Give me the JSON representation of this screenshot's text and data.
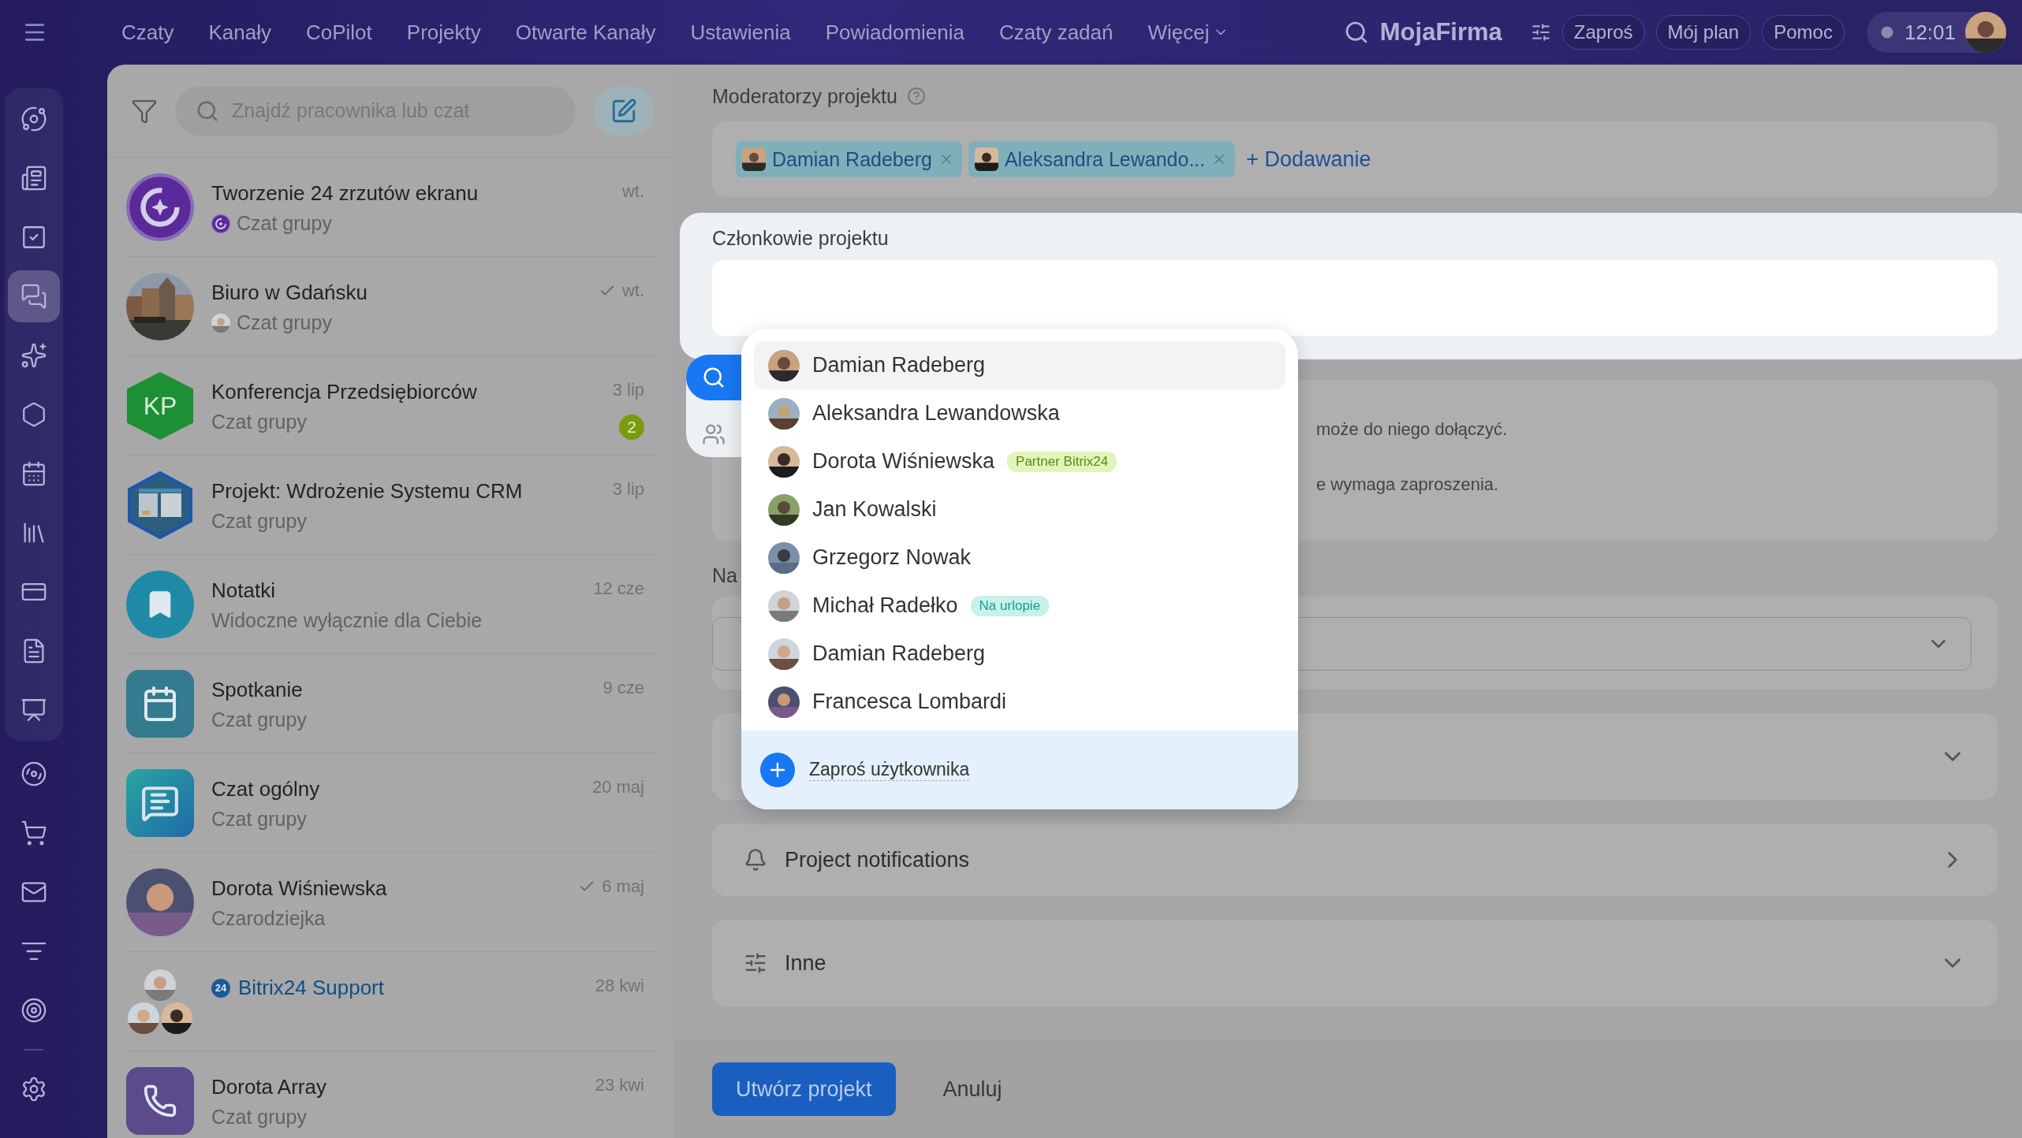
{
  "top_bar": {
    "nav": [
      "Czaty",
      "Kanały",
      "CoPilot",
      "Projekty",
      "Otwarte Kanały",
      "Ustawienia",
      "Powiadomienia",
      "Czaty zadań"
    ],
    "more": "Więcej",
    "brand": "MojaFirma",
    "buttons": [
      "Zaproś",
      "Mój plan",
      "Pomoc"
    ],
    "time": "12:01"
  },
  "rail": {
    "items": [
      {
        "selected": false
      },
      {
        "selected": false
      },
      {
        "selected": false
      },
      {
        "selected": true
      },
      {
        "selected": false
      },
      {
        "selected": false
      },
      {
        "selected": false
      },
      {
        "selected": false
      },
      {
        "selected": false
      },
      {
        "selected": false
      },
      {
        "selected": false
      },
      {
        "selected": false
      },
      {
        "selected": false
      },
      {
        "selected": false
      },
      {
        "selected": false
      },
      {
        "selected": false
      },
      {
        "selected": false
      }
    ]
  },
  "chat_list": {
    "search_placeholder": "Znajdź pracownika lub czat",
    "chats": [
      {
        "kind": "copilot",
        "title": "Tworzenie 24 zrzutów ekranu",
        "subtitle": "Czat grupy",
        "subtitle_icon": {
          "kind": "copilot"
        },
        "time": "wt.",
        "read": false
      },
      {
        "kind": "city",
        "title": "Biuro w Gdańsku",
        "subtitle": "Czat grupy",
        "subtitle_icon": {
          "kind": "person"
        },
        "time": "wt.",
        "read": true
      },
      {
        "kind": "initials",
        "title": "Konferencja Przedsiębiorców",
        "subtitle": "Czat grupy",
        "time": "3 lip",
        "read": false,
        "unread": "2",
        "initials": "KP"
      },
      {
        "kind": "hexphoto",
        "title": "Projekt: Wdrożenie Systemu CRM",
        "subtitle": "Czat grupy",
        "time": "3 lip",
        "read": false
      },
      {
        "kind": "notes",
        "title": "Notatki",
        "subtitle": "Widoczne wyłącznie dla Ciebie",
        "time": "12 cze",
        "read": false
      },
      {
        "kind": "calendar",
        "title": "Spotkanie",
        "subtitle": "Czat grupy",
        "time": "9 cze",
        "read": false
      },
      {
        "kind": "chat",
        "title": "Czat ogólny",
        "subtitle": "Czat grupy",
        "time": "20 maj",
        "read": false
      },
      {
        "title": "Dorota Wiśniewska",
        "subtitle": "Czarodziejka",
        "time": "6 maj",
        "read": true
      },
      {
        "kind": "group",
        "title": "Bitrix24 Support",
        "badge": "24",
        "time": "28 kwi",
        "read": false
      },
      {
        "kind": "phone",
        "title": "Dorota Array",
        "subtitle": "Czat grupy",
        "time": "23 kwi",
        "read": false
      }
    ]
  },
  "project_form": {
    "moderators": {
      "label": "Moderatorzy projektu",
      "chips": [
        "Damian Radeberg",
        "Aleksandra Lewando..."
      ],
      "add": "+ Dodawanie"
    },
    "members": {
      "label": "Członkowie projektu"
    },
    "info_lines": [
      "może do niego dołączyć.",
      "e wymaga zaproszenia."
    ],
    "cut_label": "Na",
    "notifications": "Project notifications",
    "other": "Inne",
    "create_button": "Utwórz projekt",
    "cancel_button": "Anuluj"
  },
  "member_picker": {
    "tabs": [
      {
        "kind": "search",
        "selected": true
      },
      {
        "kind": "people",
        "selected": false
      }
    ],
    "people": [
      {
        "name": "Damian Radeberg",
        "selected": true
      },
      {
        "name": "Aleksandra Lewandowska",
        "selected": false
      },
      {
        "name": "Dorota Wiśniewska",
        "selected": false,
        "tag": {
          "kind": "partner",
          "text": "Partner Bitrix24"
        }
      },
      {
        "name": "Jan Kowalski",
        "selected": false
      },
      {
        "name": "Grzegorz Nowak",
        "selected": false
      },
      {
        "name": "Michał Radełko",
        "selected": false,
        "tag": {
          "kind": "vacation",
          "text": "Na urlopie"
        }
      },
      {
        "name": "Damian Radeberg",
        "selected": false
      },
      {
        "name": "Francesca Lombardi",
        "selected": false
      }
    ],
    "invite": "Zaproś użytkownika"
  }
}
